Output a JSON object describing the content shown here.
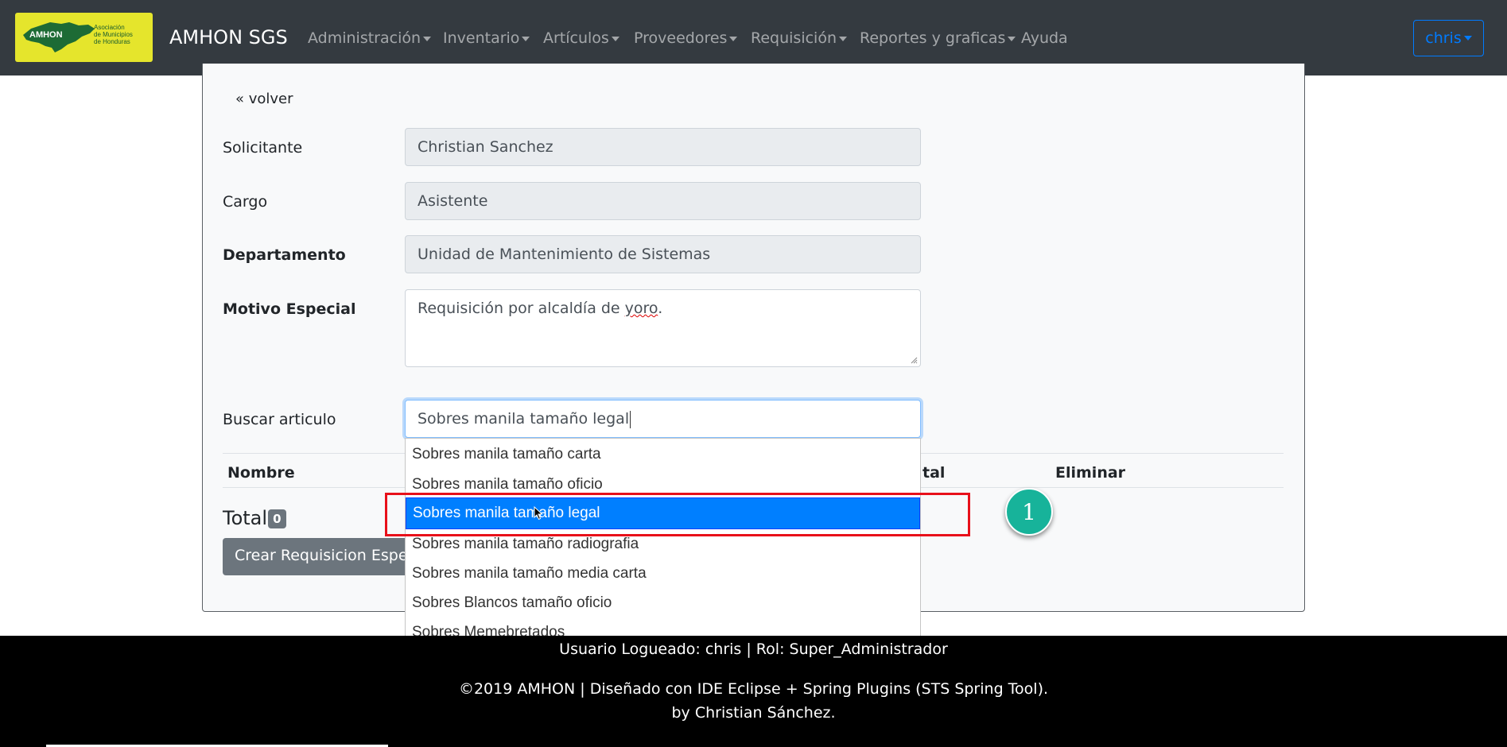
{
  "navbar": {
    "logo": {
      "mark": "AMHON",
      "text_lines": [
        "Asociación",
        "de Municipios",
        "de Honduras"
      ]
    },
    "brand": "AMHON SGS",
    "menu": [
      {
        "label": "Administración",
        "dropdown": true
      },
      {
        "label": "Inventario",
        "dropdown": true
      },
      {
        "label": "Artículos",
        "dropdown": true
      },
      {
        "label": "Proveedores",
        "dropdown": true
      },
      {
        "label": "Requisición",
        "dropdown": true
      },
      {
        "label": "Reportes y graficas",
        "dropdown": true
      },
      {
        "label": "Ayuda",
        "dropdown": false
      }
    ],
    "user": "chris"
  },
  "form": {
    "back_link": "« volver",
    "solicitante": {
      "label": "Solicitante",
      "value": "Christian Sanchez"
    },
    "cargo": {
      "label": "Cargo",
      "value": "Asistente"
    },
    "departamento": {
      "label": "Departamento",
      "value": "Unidad de Mantenimiento de Sistemas"
    },
    "motivo": {
      "label": "Motivo Especial",
      "value_before": "Requisición por alcaldía de ",
      "value_misspelled": "yoro",
      "value_after": "."
    },
    "buscar": {
      "label": "Buscar articulo",
      "value": "Sobres manila tamaño legal"
    }
  },
  "table": {
    "headers": {
      "nombre": "Nombre",
      "total_partial": "tal",
      "eliminar": "Eliminar"
    }
  },
  "summary": {
    "total_label": "Total",
    "total_count": "0",
    "create_button": "Crear Requisicion Especial"
  },
  "dropdown": {
    "items": [
      "Sobres manila tamaño carta",
      "Sobres manila tamaño oficio",
      "Sobres manila tamaño legal",
      "Sobres manila tamaño radiografia",
      "Sobres manila tamaño media carta",
      "Sobres Blancos tamaño oficio",
      "Sobres Memebretados"
    ],
    "active_index": 2
  },
  "annotation": {
    "step_number": "1",
    "highlight_color": "#e8101a",
    "badge_color": "#17b39a"
  },
  "footer": {
    "user_line": "Usuario Logueado: chris | Rol: Super_Administrador",
    "copyright": "©2019 AMHON | Diseñado con IDE Eclipse + Spring Plugins (STS Spring Tool).",
    "author": "by Christian Sánchez."
  },
  "colors": {
    "navbar_bg": "#343a40",
    "accent": "#007bff",
    "dropdown_active": "#007fff",
    "logo_bg": "#e5e52c"
  }
}
